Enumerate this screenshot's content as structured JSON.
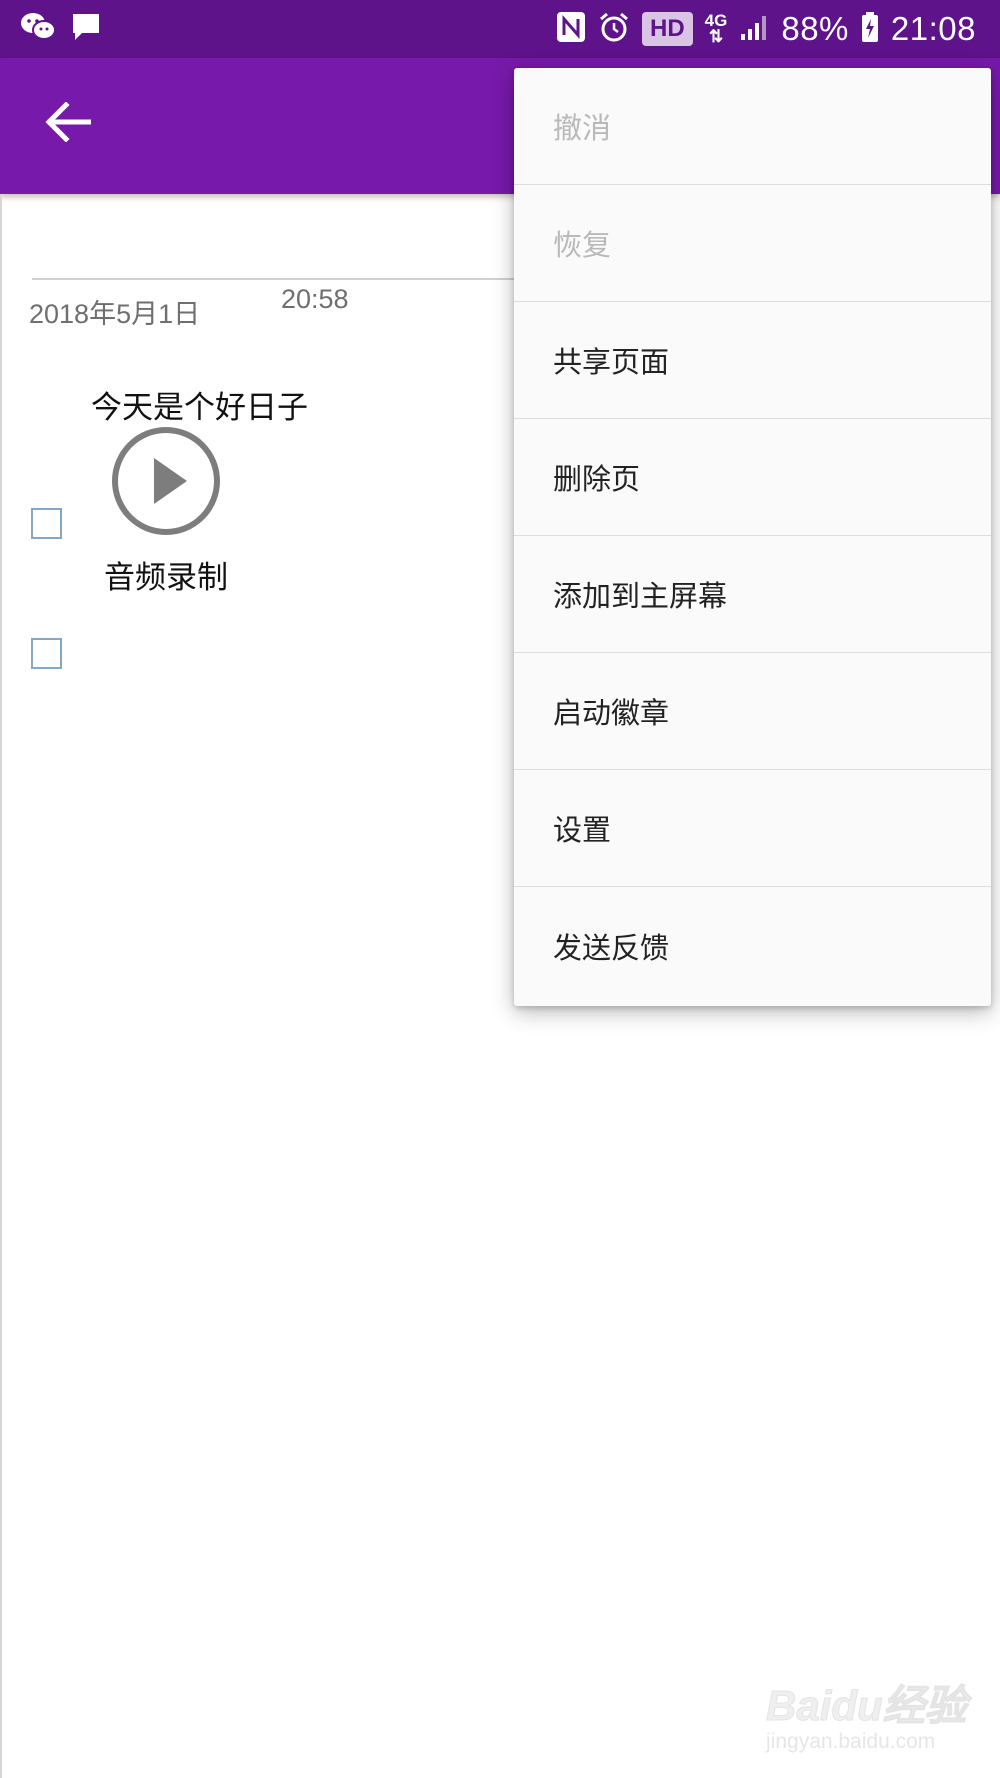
{
  "status_bar": {
    "battery": "88%",
    "time": "21:08",
    "hd_label": "HD",
    "network": "4G",
    "left_icons": [
      "wechat-icon",
      "message-icon"
    ],
    "right_icons": [
      "nfc-icon",
      "alarm-icon",
      "signal-icon",
      "battery-charging-icon"
    ]
  },
  "app_bar": {
    "back_icon": "arrow-left-icon",
    "color": "#7719aa",
    "status_color": "#5e138a"
  },
  "note": {
    "date": "2018年5月1日",
    "time": "20:58",
    "body_text": "今天是个好日子",
    "audio_label": "音频录制",
    "audio_icon": "play-circle-icon",
    "checkbox_count": 2
  },
  "menu": {
    "items": [
      {
        "label": "撤消",
        "enabled": false
      },
      {
        "label": "恢复",
        "enabled": false
      },
      {
        "label": "共享页面",
        "enabled": true
      },
      {
        "label": "删除页",
        "enabled": true
      },
      {
        "label": "添加到主屏幕",
        "enabled": true
      },
      {
        "label": "启动徽章",
        "enabled": true
      },
      {
        "label": "设置",
        "enabled": true
      },
      {
        "label": "发送反馈",
        "enabled": true
      }
    ]
  },
  "watermark": {
    "logo": "Baidu经验",
    "url": "jingyan.baidu.com"
  }
}
